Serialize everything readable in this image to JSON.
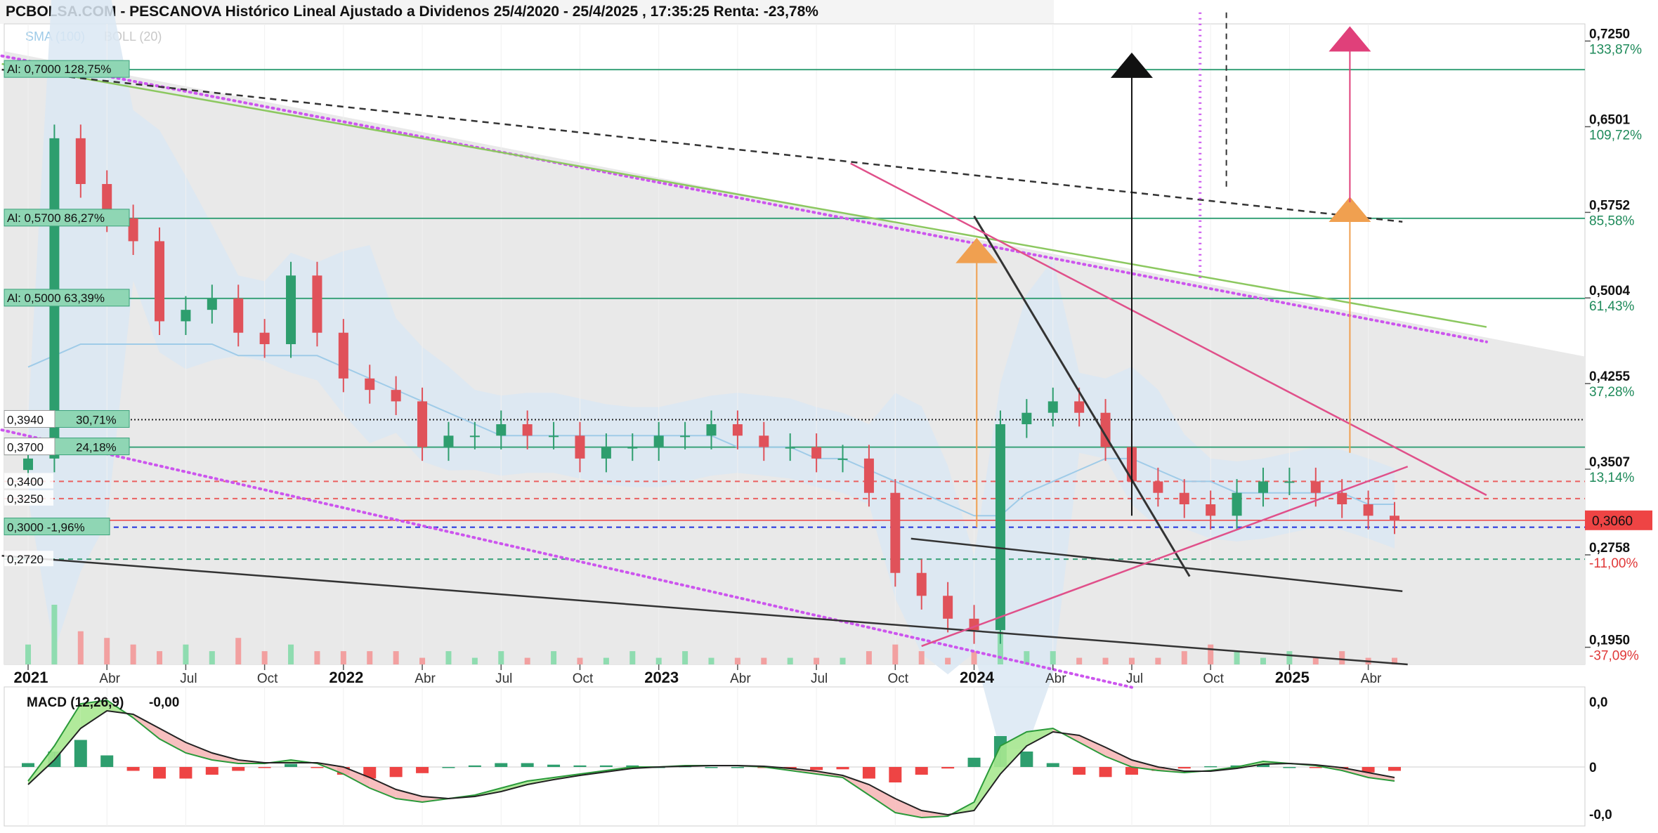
{
  "header": {
    "title": "PCBOLSA.COM - PESCANOVA Histórico Lineal Ajustado a Dividenos 25/4/2020 - 25/4/2025 , 17:35:25 Renta: -23,78%",
    "sma_label": "SMA (100)",
    "boll_label": "BOLL (20)"
  },
  "colors": {
    "up": "#2e9e6e",
    "down": "#e0525a",
    "sma": "#9fcbe8",
    "boll_fill": "#dbe8f3",
    "support_line": "#3aa27a",
    "trend_purple": "#cc55ee",
    "trend_pink": "#e0508a",
    "trend_green": "#8cc860",
    "trend_dark": "#333333",
    "last_price_bg": "#ee4444"
  },
  "chart_data": {
    "type": "line",
    "title": "PCBOLSA.COM - PESCANOVA Histórico Lineal Ajustado a Dividenos 25/4/2020 - 25/4/2025 , 17:35:25 Renta: -23,78%",
    "ylim": [
      0.18,
      0.74
    ],
    "x_ticks": [
      {
        "label": "2021",
        "bold": true
      },
      {
        "label": "Abr"
      },
      {
        "label": "Jul"
      },
      {
        "label": "Oct"
      },
      {
        "label": "2022",
        "bold": true
      },
      {
        "label": "Abr"
      },
      {
        "label": "Jul"
      },
      {
        "label": "Oct"
      },
      {
        "label": "2023",
        "bold": true
      },
      {
        "label": "Abr"
      },
      {
        "label": "Jul"
      },
      {
        "label": "Oct"
      },
      {
        "label": "2024",
        "bold": true
      },
      {
        "label": "Abr"
      },
      {
        "label": "Jul"
      },
      {
        "label": "Oct"
      },
      {
        "label": "2025",
        "bold": true
      },
      {
        "label": "Abr"
      }
    ],
    "x_tick_pos": [
      0,
      3,
      6,
      9,
      12,
      15,
      18,
      21,
      24,
      27,
      30,
      33,
      36,
      39,
      42,
      45,
      48,
      51
    ],
    "y_axis_labels": [
      {
        "price": "0,7250",
        "pct": "133,87%",
        "value": 0.725,
        "pct_color": "#1e8a5a"
      },
      {
        "price": "0,6501",
        "pct": "109,72%",
        "value": 0.6501,
        "pct_color": "#1e8a5a"
      },
      {
        "price": "0,5752",
        "pct": "85,58%",
        "value": 0.5752,
        "pct_color": "#1e8a5a"
      },
      {
        "price": "0,5004",
        "pct": "61,43%",
        "value": 0.5004,
        "pct_color": "#1e8a5a"
      },
      {
        "price": "0,4255",
        "pct": "37,28%",
        "value": 0.4255,
        "pct_color": "#1e8a5a"
      },
      {
        "price": "0,3507",
        "pct": "13,14%",
        "value": 0.3507,
        "pct_color": "#1e8a5a"
      },
      {
        "price": "0,2758",
        "pct": "-11,00%",
        "value": 0.2758,
        "pct_color": "#e03838"
      },
      {
        "price": "0,1950",
        "pct": "-37,09%",
        "value": 0.195,
        "pct_color": "#e03838"
      }
    ],
    "last_price": {
      "label": "0,3060",
      "value": 0.306
    },
    "resistance_levels": [
      {
        "label": "Al: 0,7000  128,75%",
        "value": 0.7
      },
      {
        "label": "Al: 0,5700  86,27%",
        "value": 0.57
      },
      {
        "label": "Al: 0,5000  63,39%",
        "value": 0.5
      }
    ],
    "level_lines": [
      {
        "label": "0,3940",
        "value": 0.394,
        "pct": "30,71%",
        "style": "dotted"
      },
      {
        "label": "0,3700",
        "value": 0.37,
        "pct": "24,18%",
        "style": "solid"
      },
      {
        "label": "0,3400",
        "value": 0.34,
        "style": "red-dashed"
      },
      {
        "label": "0,3250",
        "value": 0.325,
        "style": "red-dashed"
      },
      {
        "label": "0,3000  -1,96%",
        "value": 0.3,
        "style": "blue-dashed"
      },
      {
        "label": "0,2720",
        "value": 0.272,
        "style": "green-dashed"
      }
    ],
    "series": [
      {
        "values": [
          0.36,
          0.64,
          0.6,
          0.57,
          0.55,
          0.48,
          0.49,
          0.5,
          0.47,
          0.46,
          0.52,
          0.47,
          0.43,
          0.42,
          0.41,
          0.37,
          0.38,
          0.38,
          0.39,
          0.38,
          0.38,
          0.36,
          0.37,
          0.37,
          0.38,
          0.38,
          0.39,
          0.38,
          0.37,
          0.37,
          0.36,
          0.36,
          0.33,
          0.26,
          0.24,
          0.22,
          0.21,
          0.39,
          0.4,
          0.41,
          0.4,
          0.37,
          0.34,
          0.33,
          0.32,
          0.31,
          0.33,
          0.34,
          0.34,
          0.33,
          0.32,
          0.31,
          0.306
        ]
      }
    ],
    "sma100": [
      0.44,
      0.45,
      0.46,
      0.46,
      0.46,
      0.46,
      0.46,
      0.46,
      0.45,
      0.45,
      0.45,
      0.45,
      0.44,
      0.43,
      0.42,
      0.41,
      0.4,
      0.39,
      0.38,
      0.38,
      0.38,
      0.38,
      0.38,
      0.38,
      0.38,
      0.38,
      0.38,
      0.37,
      0.37,
      0.37,
      0.36,
      0.36,
      0.35,
      0.34,
      0.33,
      0.32,
      0.31,
      0.31,
      0.33,
      0.34,
      0.35,
      0.36,
      0.36,
      0.35,
      0.34,
      0.34,
      0.33,
      0.33,
      0.33,
      0.33,
      0.33,
      0.32,
      0.32
    ],
    "volume": [
      3,
      9,
      5,
      4,
      3,
      2,
      3,
      2,
      4,
      2,
      3,
      2,
      2,
      2,
      2,
      1,
      2,
      1,
      2,
      1,
      2,
      1,
      1,
      2,
      1,
      2,
      1,
      1,
      1,
      1,
      1,
      1,
      2,
      3,
      2,
      1,
      2,
      5,
      2,
      2,
      1,
      1,
      1,
      1,
      2,
      3,
      2,
      1,
      2,
      1,
      2,
      1,
      1
    ],
    "macd": {
      "label": "MACD (12,26,9)",
      "value": "-0,00",
      "y_labels": [
        {
          "text": "0,0",
          "color": "#e03030"
        },
        {
          "text": "0",
          "color": "#111"
        },
        {
          "text": "-0,0",
          "color": "#1e8a5a"
        }
      ],
      "macd_line": [
        -0.2,
        0.3,
        0.9,
        0.95,
        0.7,
        0.4,
        0.2,
        0.1,
        0.05,
        0.05,
        0.1,
        0.05,
        -0.1,
        -0.3,
        -0.45,
        -0.5,
        -0.45,
        -0.4,
        -0.3,
        -0.2,
        -0.15,
        -0.1,
        -0.05,
        0.0,
        0.0,
        0.02,
        0.02,
        0.02,
        0.0,
        -0.05,
        -0.1,
        -0.15,
        -0.4,
        -0.65,
        -0.72,
        -0.7,
        -0.5,
        0.3,
        0.5,
        0.55,
        0.35,
        0.15,
        0.0,
        -0.05,
        -0.08,
        -0.05,
        0.0,
        0.08,
        0.05,
        0.02,
        -0.05,
        -0.15,
        -0.2
      ],
      "signal_line": [
        -0.25,
        0.1,
        0.55,
        0.8,
        0.75,
        0.55,
        0.35,
        0.2,
        0.1,
        0.06,
        0.06,
        0.06,
        0.0,
        -0.15,
        -0.32,
        -0.42,
        -0.45,
        -0.42,
        -0.35,
        -0.25,
        -0.18,
        -0.12,
        -0.07,
        -0.02,
        0.0,
        0.01,
        0.02,
        0.02,
        0.01,
        -0.02,
        -0.06,
        -0.12,
        -0.25,
        -0.45,
        -0.62,
        -0.68,
        -0.62,
        -0.1,
        0.3,
        0.5,
        0.45,
        0.28,
        0.1,
        0.0,
        -0.06,
        -0.06,
        -0.02,
        0.04,
        0.05,
        0.03,
        -0.01,
        -0.08,
        -0.15
      ]
    }
  }
}
